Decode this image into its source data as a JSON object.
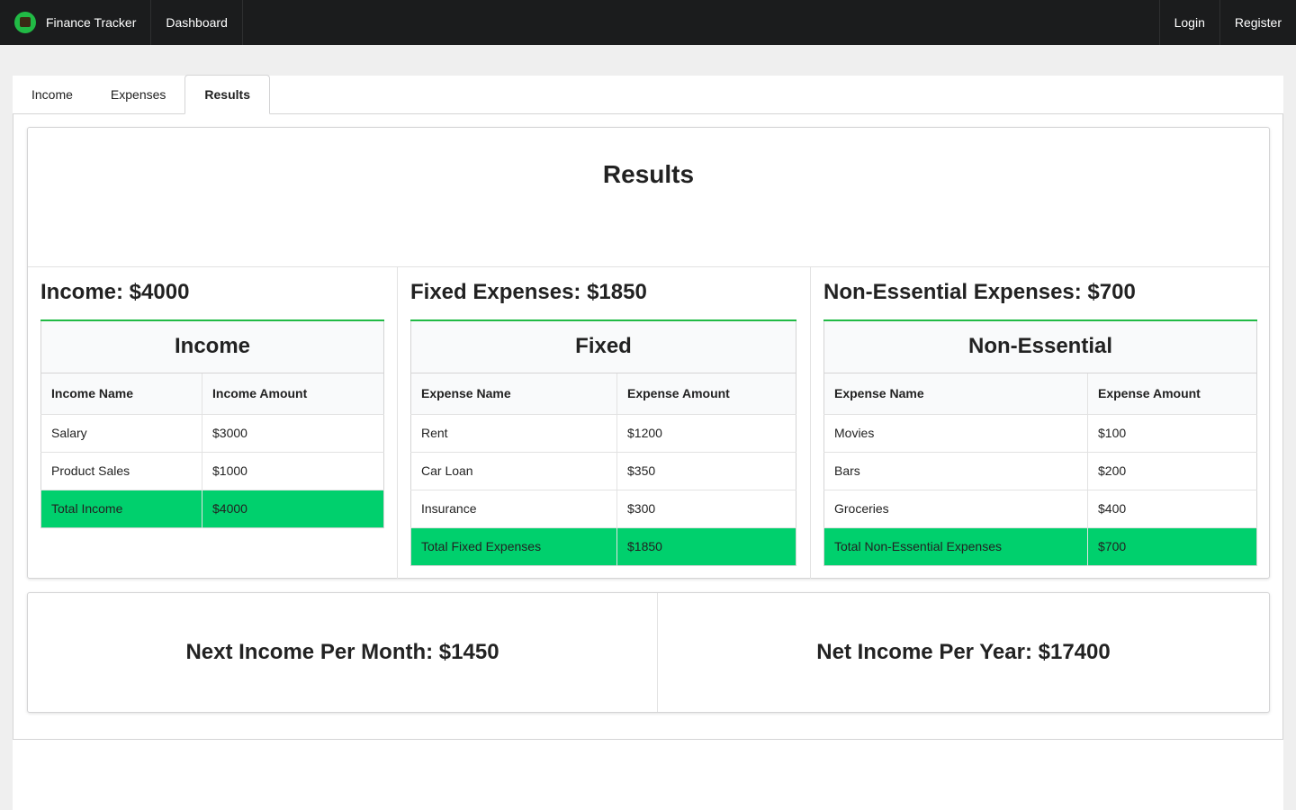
{
  "navbar": {
    "brand": "Finance Tracker",
    "links": [
      "Dashboard"
    ],
    "right_links": [
      "Login",
      "Register"
    ]
  },
  "tabs": [
    {
      "label": "Income",
      "active": false
    },
    {
      "label": "Expenses",
      "active": false
    },
    {
      "label": "Results",
      "active": true
    }
  ],
  "results": {
    "title": "Results",
    "columns": [
      {
        "heading": "Income: $4000",
        "table_title": "Income",
        "headers": [
          "Income Name",
          "Income Amount"
        ],
        "rows": [
          [
            "Salary",
            "$3000"
          ],
          [
            "Product Sales",
            "$1000"
          ]
        ],
        "total": [
          "Total Income",
          "$4000"
        ]
      },
      {
        "heading": "Fixed Expenses: $1850",
        "table_title": "Fixed",
        "headers": [
          "Expense Name",
          "Expense Amount"
        ],
        "rows": [
          [
            "Rent",
            "$1200"
          ],
          [
            "Car Loan",
            "$350"
          ],
          [
            "Insurance",
            "$300"
          ]
        ],
        "total": [
          "Total Fixed Expenses",
          "$1850"
        ]
      },
      {
        "heading": "Non-Essential Expenses: $700",
        "table_title": "Non-Essential",
        "headers": [
          "Expense Name",
          "Expense Amount"
        ],
        "rows": [
          [
            "Movies",
            "$100"
          ],
          [
            "Bars",
            "$200"
          ],
          [
            "Groceries",
            "$400"
          ]
        ],
        "total": [
          "Total Non-Essential Expenses",
          "$700"
        ]
      }
    ],
    "net_month": "Next Income Per Month: $1450",
    "net_year": "Net Income Per Year: $17400"
  },
  "colors": {
    "navbar_bg": "#1b1c1d",
    "accent_green": "#21ba45",
    "total_row_green": "#00d06d"
  },
  "icons": {
    "brand": "piggy-bank-logo-icon"
  }
}
